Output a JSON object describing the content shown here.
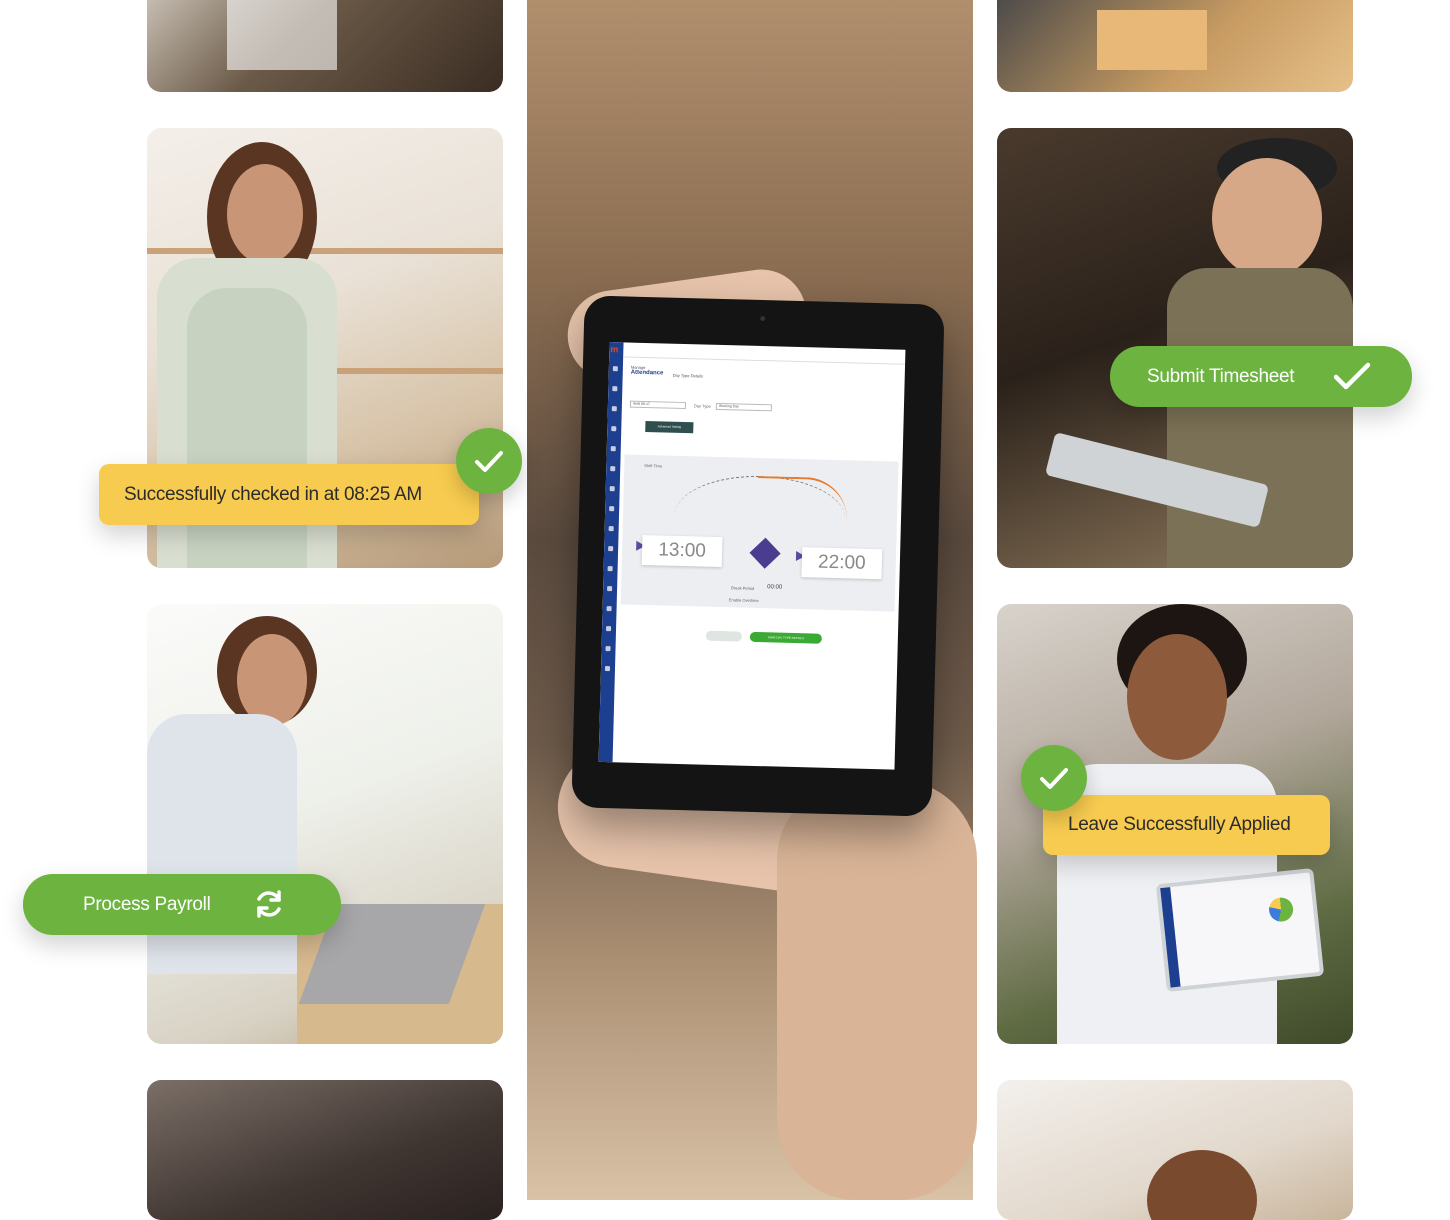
{
  "toasts": {
    "checked_in": "Successfully checked in at 08:25 AM",
    "submit_timesheet": "Submit Timesheet",
    "process_payroll": "Process Payroll",
    "leave_applied": "Leave Successfully Applied"
  },
  "tablet_app": {
    "breadcrumb_parent": "Manage",
    "breadcrumb_title": "Attendance",
    "breadcrumb_sub": "Day Type Details",
    "select_1": "Shift 09-17",
    "select_2_label": "Day Type",
    "select_2_value": "Working Day",
    "advanced_button": "Advanced Setting",
    "shift_label": "Shift Time",
    "start_time": "13:00",
    "end_time": "22:00",
    "break_label": "Break Period",
    "break_value": "00:00",
    "overtime_label": "Enable Overtime",
    "cancel_button": "Cancel",
    "save_button": "SAVE DAY TYPE DETAILS"
  },
  "icons": [
    "check-icon",
    "refresh-icon"
  ],
  "colors": {
    "green": "#6cb33f",
    "yellow": "#f7cb4f",
    "app_sidebar": "#1d3f8f",
    "app_accent": "#e8782a"
  }
}
